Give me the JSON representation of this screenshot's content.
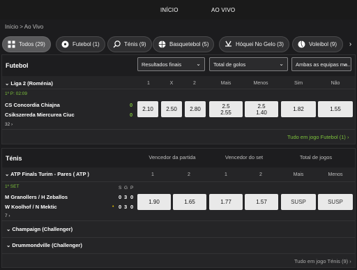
{
  "nav": {
    "home": "INÍCIO",
    "live": "AO VIVO"
  },
  "breadcrumb": "Início > Ao Vivo",
  "chips": [
    {
      "label": "Todos (29)",
      "icon": "grid-icon"
    },
    {
      "label": "Futebol (1)",
      "icon": "soccer-ball-icon"
    },
    {
      "label": "Ténis (9)",
      "icon": "tennis-racket-icon"
    },
    {
      "label": "Basquetebol (5)",
      "icon": "basketball-icon"
    },
    {
      "label": "Hóquei No Gelo (3)",
      "icon": "hockey-stick-icon"
    },
    {
      "label": "Voleibol (9)",
      "icon": "volleyball-icon"
    }
  ],
  "football": {
    "title": "Futebol",
    "filters": [
      "Resultados finais",
      "Total de golos",
      "Ambas as equipas ma..."
    ],
    "league": "Liga 2 (Roménia)",
    "col_headers": [
      "1",
      "X",
      "2",
      "Mais",
      "Menos",
      "Sim",
      "Não"
    ],
    "match": {
      "period": "1º P: 02:09",
      "home": "CS Concordia Chiajna",
      "away": "Csikszereda Miercurea Ciuc",
      "home_score": "0",
      "away_score": "0",
      "more": "32",
      "odds": [
        {
          "top": "2.10"
        },
        {
          "top": "2.50"
        },
        {
          "top": "2.80"
        },
        {
          "top": "2.5",
          "bottom": "2.55"
        },
        {
          "top": "2.5",
          "bottom": "1.40"
        },
        {
          "top": "1.82"
        },
        {
          "top": "1.55"
        }
      ]
    },
    "all_link": "Tudo em jogo Futebol (1)"
  },
  "tennis": {
    "title": "Ténis",
    "groups": [
      "Vencedor da partida",
      "Vencedor do set",
      "Total de jogos"
    ],
    "league": "ATP Finals Turim - Pares ( ATP )",
    "col_headers": [
      "1",
      "2",
      "1",
      "2",
      "Mais",
      "Menos"
    ],
    "match": {
      "set": "1º SET",
      "sgp": [
        "S",
        "G",
        "P"
      ],
      "home": "M Granollers / H Zeballos",
      "away": "W Koolhof / N Mektic",
      "home_score": [
        "0",
        "3",
        "0"
      ],
      "away_score": [
        "0",
        "3",
        "0"
      ],
      "more": "7",
      "odds": [
        "1.90",
        "1.65",
        "1.77",
        "1.57",
        "SUSP",
        "SUSP"
      ]
    },
    "other_leagues": [
      "Champaign (Challenger)",
      "Drummondville (Challenger)"
    ],
    "all_link": "Tudo em jogo Ténis (9)"
  },
  "colors": {
    "accent_green": "#7cc13b",
    "odd_bg": "#e9e9e9",
    "page_bg": "#1c1c1e"
  }
}
